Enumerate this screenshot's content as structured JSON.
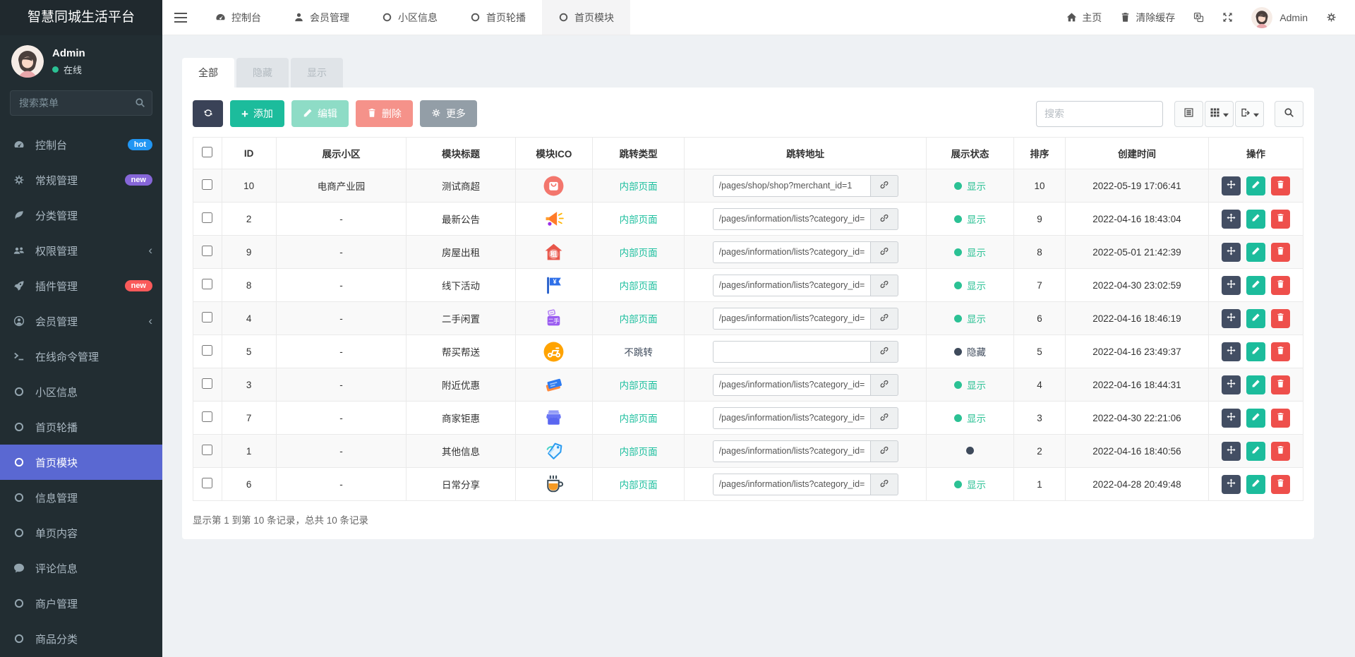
{
  "app": {
    "title": "智慧同城生活平台"
  },
  "user": {
    "name": "Admin",
    "status": "在线"
  },
  "sidebar": {
    "search_placeholder": "搜索菜单",
    "items": [
      {
        "id": "console",
        "label": "控制台",
        "icon": "dashboard-icon",
        "badge": "hot",
        "badge_color": "#2196f3"
      },
      {
        "id": "general",
        "label": "常规管理",
        "icon": "gears-icon",
        "badge": "new",
        "badge_color": "#8666d8"
      },
      {
        "id": "category",
        "label": "分类管理",
        "icon": "leaf-icon"
      },
      {
        "id": "permission",
        "label": "权限管理",
        "icon": "users-icon",
        "arrow": true
      },
      {
        "id": "plugin",
        "label": "插件管理",
        "icon": "rocket-icon",
        "badge": "new",
        "badge_color": "#fa5a5a"
      },
      {
        "id": "member",
        "label": "会员管理",
        "icon": "user-circle-icon",
        "arrow": true
      },
      {
        "id": "online-command",
        "label": "在线命令管理",
        "icon": "terminal-icon"
      },
      {
        "id": "community-info",
        "label": "小区信息",
        "icon": "circle-icon"
      },
      {
        "id": "home-carousel",
        "label": "首页轮播",
        "icon": "circle-icon"
      },
      {
        "id": "home-module",
        "label": "首页模块",
        "icon": "circle-icon",
        "active": true
      },
      {
        "id": "info-manage",
        "label": "信息管理",
        "icon": "circle-icon"
      },
      {
        "id": "single-page",
        "label": "单页内容",
        "icon": "circle-icon"
      },
      {
        "id": "comments",
        "label": "评论信息",
        "icon": "comment-icon"
      },
      {
        "id": "merchant",
        "label": "商户管理",
        "icon": "circle-icon"
      },
      {
        "id": "goods-category",
        "label": "商品分类",
        "icon": "circle-icon"
      }
    ]
  },
  "navbar": {
    "tabs": [
      {
        "id": "console",
        "label": "控制台",
        "icon": "dashboard-icon"
      },
      {
        "id": "member",
        "label": "会员管理",
        "icon": "user-icon"
      },
      {
        "id": "community-info",
        "label": "小区信息",
        "icon": "circle-icon"
      },
      {
        "id": "home-carousel",
        "label": "首页轮播",
        "icon": "circle-icon"
      },
      {
        "id": "home-module",
        "label": "首页模块",
        "icon": "circle-icon",
        "active": true
      }
    ],
    "home_label": "主页",
    "clear_cache_label": "清除缓存",
    "username": "Admin"
  },
  "content": {
    "filter_tabs": [
      {
        "label": "全部",
        "active": true
      },
      {
        "label": "隐藏"
      },
      {
        "label": "显示"
      }
    ],
    "toolbar": {
      "add": "添加",
      "edit": "编辑",
      "delete": "删除",
      "more": "更多",
      "search_placeholder": "搜索"
    },
    "table": {
      "columns": [
        "ID",
        "展示小区",
        "模块标题",
        "模块ICO",
        "跳转类型",
        "跳转地址",
        "展示状态",
        "排序",
        "创建时间",
        "操作"
      ],
      "rows": [
        {
          "id": "10",
          "community": "电商产业园",
          "title": "测试商超",
          "ico": "shopping-bag-icon",
          "jump_type": "内部页面",
          "jump_kind": "internal",
          "url": "/pages/shop/shop?merchant_id=1",
          "status": "显示",
          "status_kind": "show",
          "sort": "10",
          "created": "2022-05-19 17:06:41"
        },
        {
          "id": "2",
          "community": "-",
          "title": "最新公告",
          "ico": "megaphone-icon",
          "jump_type": "内部页面",
          "jump_kind": "internal",
          "url": "/pages/information/lists?category_id=",
          "status": "显示",
          "status_kind": "show",
          "sort": "9",
          "created": "2022-04-16 18:43:04"
        },
        {
          "id": "9",
          "community": "-",
          "title": "房屋出租",
          "ico": "house-rent-icon",
          "jump_type": "内部页面",
          "jump_kind": "internal",
          "url": "/pages/information/lists?category_id=",
          "status": "显示",
          "status_kind": "show",
          "sort": "8",
          "created": "2022-05-01 21:42:39"
        },
        {
          "id": "8",
          "community": "-",
          "title": "线下活动",
          "ico": "flag-icon",
          "jump_type": "内部页面",
          "jump_kind": "internal",
          "url": "/pages/information/lists?category_id=",
          "status": "显示",
          "status_kind": "show",
          "sort": "7",
          "created": "2022-04-30 23:02:59"
        },
        {
          "id": "4",
          "community": "-",
          "title": "二手闲置",
          "ico": "secondhand-box-icon",
          "jump_type": "内部页面",
          "jump_kind": "internal",
          "url": "/pages/information/lists?category_id=",
          "status": "显示",
          "status_kind": "show",
          "sort": "6",
          "created": "2022-04-16 18:46:19"
        },
        {
          "id": "5",
          "community": "-",
          "title": "帮买帮送",
          "ico": "scooter-icon",
          "jump_type": "不跳转",
          "jump_kind": "none",
          "url": "",
          "status": "隐藏",
          "status_kind": "hide",
          "sort": "5",
          "created": "2022-04-16 23:49:37"
        },
        {
          "id": "3",
          "community": "-",
          "title": "附近优惠",
          "ico": "tickets-icon",
          "jump_type": "内部页面",
          "jump_kind": "internal",
          "url": "/pages/information/lists?category_id=",
          "status": "显示",
          "status_kind": "show",
          "sort": "4",
          "created": "2022-04-16 18:44:31"
        },
        {
          "id": "7",
          "community": "-",
          "title": "商家钜惠",
          "ico": "storefront-icon",
          "jump_type": "内部页面",
          "jump_kind": "internal",
          "url": "/pages/information/lists?category_id=",
          "status": "显示",
          "status_kind": "show",
          "sort": "3",
          "created": "2022-04-30 22:21:06"
        },
        {
          "id": "1",
          "community": "-",
          "title": "其他信息",
          "ico": "tag-icon",
          "jump_type": "内部页面",
          "jump_kind": "internal",
          "url": "/pages/information/lists?category_id=",
          "status": "",
          "status_kind": "dot",
          "sort": "2",
          "created": "2022-04-16 18:40:56"
        },
        {
          "id": "6",
          "community": "-",
          "title": "日常分享",
          "ico": "coffee-icon",
          "jump_type": "内部页面",
          "jump_kind": "internal",
          "url": "/pages/information/lists?category_id=",
          "status": "显示",
          "status_kind": "show",
          "sort": "1",
          "created": "2022-04-28 20:49:48"
        }
      ]
    },
    "pagination": "显示第 1 到第 10 条记录，总共 10 条记录"
  },
  "colors": {
    "accent_green": "#1cbc9c",
    "active_menu": "#5a68d2",
    "sidebar_bg": "#222d32",
    "status_show": "#2bc194",
    "status_hide": "#3e4a5b",
    "danger": "#ee4f4b"
  }
}
